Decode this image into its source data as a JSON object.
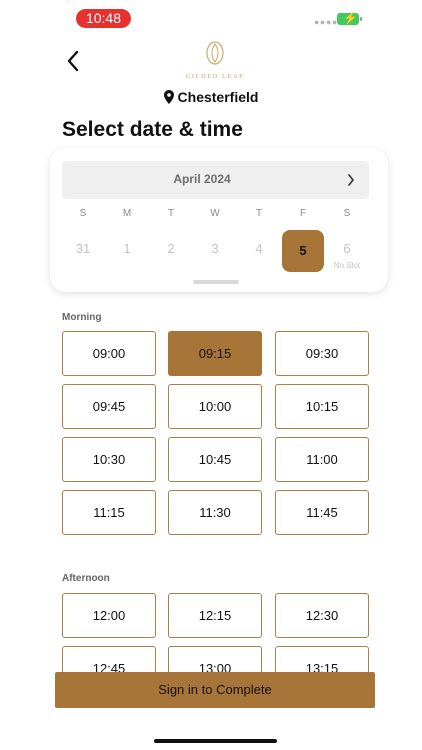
{
  "status_bar": {
    "time": "10:48"
  },
  "header": {
    "logo_text": "GILDED LEAF",
    "location": "Chesterfield",
    "title": "Select date & time"
  },
  "calendar": {
    "month": "April 2024",
    "weekdays": [
      "S",
      "M",
      "T",
      "W",
      "T",
      "F",
      "S"
    ],
    "days": [
      "31",
      "1",
      "2",
      "3",
      "4",
      "5",
      "6"
    ],
    "selected_day": "5",
    "day_note": "No Slot"
  },
  "morning": {
    "label": "Morning",
    "slots": [
      "09:00",
      "09:15",
      "09:30",
      "09:45",
      "10:00",
      "10:15",
      "10:30",
      "10:45",
      "11:00",
      "11:15",
      "11:30",
      "11:45"
    ],
    "selected": "09:15"
  },
  "afternoon": {
    "label": "Afternoon",
    "slots": [
      "12:00",
      "12:15",
      "12:30",
      "12:45",
      "13:00",
      "13:15"
    ]
  },
  "cta_label": "Sign in to Complete",
  "colors": {
    "accent": "#a87539",
    "slot_border": "#b07f48"
  }
}
